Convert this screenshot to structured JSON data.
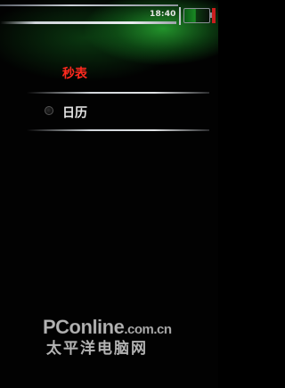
{
  "status_bar": {
    "time": "18:40",
    "battery_icon": "battery-icon",
    "signal_icon": "signal-icon"
  },
  "menu": {
    "items": [
      {
        "label": "秒表",
        "selected": true
      },
      {
        "label": "日历",
        "selected": false
      }
    ]
  },
  "watermark": {
    "line1_main": "PConline",
    "line1_suffix": ".com.cn",
    "line2": "太平洋电脑网"
  },
  "colors": {
    "selected_text": "#ff2a1f",
    "normal_text": "#e6e6e6",
    "glow": "#28aa32"
  }
}
